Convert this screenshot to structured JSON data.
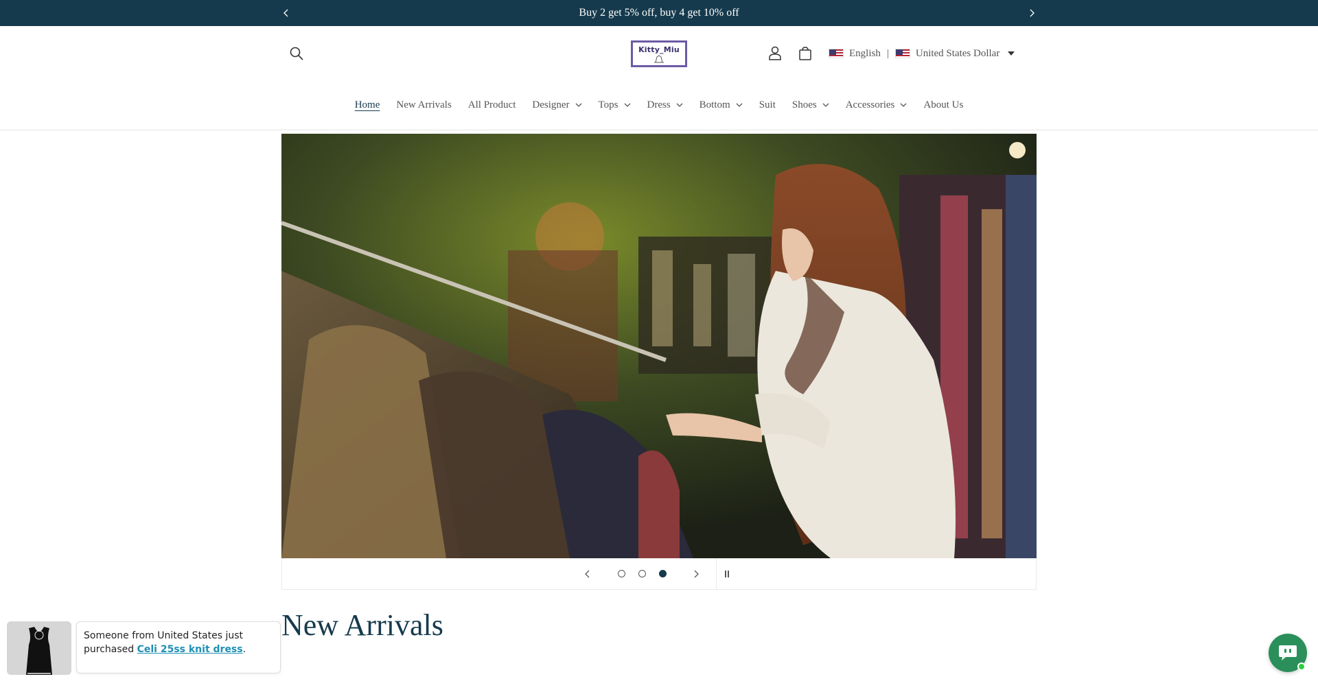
{
  "announcement": {
    "text": "Buy 2 get 5% off, buy 4 get 10% off"
  },
  "brand": {
    "logo_text": "Kitty_Miu"
  },
  "locale": {
    "language": "English",
    "currency": "United States Dollar",
    "separator": "|"
  },
  "nav": {
    "items": [
      {
        "label": "Home",
        "active": true,
        "dropdown": false
      },
      {
        "label": "New Arrivals",
        "dropdown": false
      },
      {
        "label": "All Product",
        "dropdown": false
      },
      {
        "label": "Designer",
        "dropdown": true
      },
      {
        "label": "Tops",
        "dropdown": true
      },
      {
        "label": "Dress",
        "dropdown": true
      },
      {
        "label": "Bottom",
        "dropdown": true
      },
      {
        "label": "Suit",
        "dropdown": false
      },
      {
        "label": "Shoes",
        "dropdown": true
      },
      {
        "label": "Accessories",
        "dropdown": true
      },
      {
        "label": "About Us",
        "dropdown": false
      }
    ]
  },
  "slider": {
    "slide_count": 3,
    "active_index": 3
  },
  "sections": {
    "new_arrivals_title": "New Arrivals"
  },
  "popup": {
    "text_prefix": "Someone from United States just purchased ",
    "product_link": "Celi 25ss knit dress",
    "text_suffix": "."
  },
  "colors": {
    "accent": "#163a4d",
    "link": "#1f8fb4",
    "chat": "#2a8f5a"
  }
}
